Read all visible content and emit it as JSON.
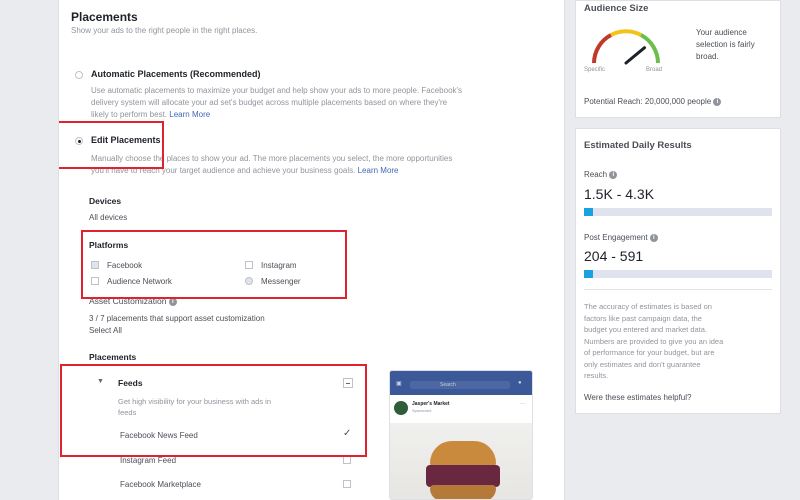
{
  "placements_section": {
    "title": "Placements",
    "subtitle": "Show your ads to the right people in the right places.",
    "automatic": {
      "title": "Automatic Placements (Recommended)",
      "desc_1": "Use automatic placements to maximize your budget and help show your ads to more people. Facebook's",
      "desc_2": "delivery system will allocate your ad set's budget across multiple placements based on where they're",
      "desc_3": "likely to perform best.",
      "link": "Learn More",
      "selected": false
    },
    "edit": {
      "title": "Edit Placements",
      "desc_1": "Manually choose the places to show your ad. The more placements you select, the more opportunities",
      "desc_2": "you'll have to reach your target audience and achieve your business goals.",
      "link": "Learn More",
      "selected": true
    },
    "devices": {
      "label": "Devices",
      "value": "All devices"
    },
    "platforms": {
      "label": "Platforms",
      "items": [
        "Facebook",
        "Audience Network",
        "Instagram",
        "Messenger"
      ]
    },
    "asset_customization": {
      "label": "Asset Customization",
      "count_text": "3 / 7 placements that support asset customization",
      "select_all": "Select All"
    },
    "placements_list": {
      "label": "Placements",
      "feeds": {
        "title": "Feeds",
        "desc_1": "Get high visibility for your business with ads in",
        "desc_2": "feeds"
      },
      "items": [
        "Facebook News Feed",
        "Instagram Feed",
        "Facebook Marketplace"
      ]
    }
  },
  "preview": {
    "search": "Search",
    "page_name": "Jasper's Market",
    "sponsored": "Sponsored"
  },
  "audience_size": {
    "title": "Audience Size",
    "gauge_left": "Specific",
    "gauge_right": "Broad",
    "gauge_level": 0.78,
    "summary_1": "Your audience",
    "summary_2": "selection is fairly",
    "summary_3": "broad.",
    "potential_reach": "Potential Reach: 20,000,000 people"
  },
  "daily_results": {
    "title": "Estimated Daily Results",
    "reach_label": "Reach",
    "reach_value": "1.5K - 4.3K",
    "reach_fill": 0.05,
    "engagement_label": "Post Engagement",
    "engagement_value": "204 - 591",
    "engagement_fill": 0.05,
    "disclaimer": [
      "The accuracy of estimates is based on",
      "factors like past campaign data, the",
      "budget you entered and market data.",
      "Numbers are provided to give you an idea",
      "of performance for your budget, but are",
      "only estimates and don't guarantee",
      "results."
    ],
    "helpful_link": "Were these estimates helpful?"
  },
  "colors": {
    "highlight_box": "#e0212e",
    "link": "#4267b2",
    "bar_fill": "#1aa1e0",
    "facebook_blue": "#3b5998"
  }
}
